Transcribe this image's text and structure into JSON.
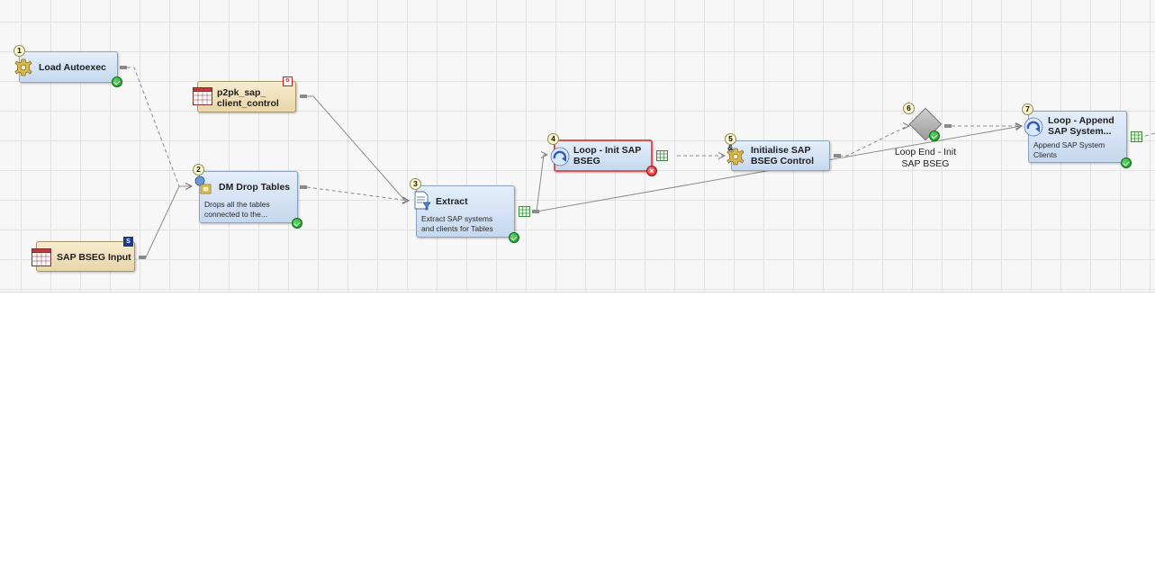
{
  "nodes": {
    "n1": {
      "number": "1",
      "title": "Load Autoexec",
      "status": "success"
    },
    "t1": {
      "title_lines": [
        "p2pk_sap_",
        "client_control"
      ],
      "corner_mark": "o"
    },
    "n2": {
      "number": "2",
      "title": "DM Drop Tables",
      "desc_lines": [
        "Drops all the tables",
        "connected to the..."
      ],
      "status": "success"
    },
    "t2": {
      "title": "SAP BSEG Input",
      "corner_mark": "S"
    },
    "n3": {
      "number": "3",
      "title": "Extract",
      "desc_lines": [
        "Extract SAP systems",
        "and clients for Tables"
      ],
      "status": "success"
    },
    "n4": {
      "number": "4",
      "title_lines": [
        "Loop - Init SAP",
        "BSEG"
      ],
      "status": "error"
    },
    "n5": {
      "number": "5",
      "title_lines": [
        "Initialise SAP",
        "BSEG Control"
      ],
      "prefix": "&"
    },
    "n6": {
      "number": "6",
      "label_lines": [
        "Loop End - Init",
        "SAP BSEG"
      ],
      "status": "success"
    },
    "n7": {
      "number": "7",
      "title_lines": [
        "Loop - Append",
        "SAP System..."
      ],
      "desc_lines": [
        "Append SAP System",
        "Clients"
      ],
      "status": "success"
    }
  },
  "status_icons": {
    "success": "check-icon",
    "error": "x-icon"
  },
  "colors": {
    "transform_fill": "#d4e3f5",
    "table_fill": "#efe1bb",
    "selected_border": "#e05050",
    "success": "#16941f",
    "error": "#d41c1c"
  }
}
